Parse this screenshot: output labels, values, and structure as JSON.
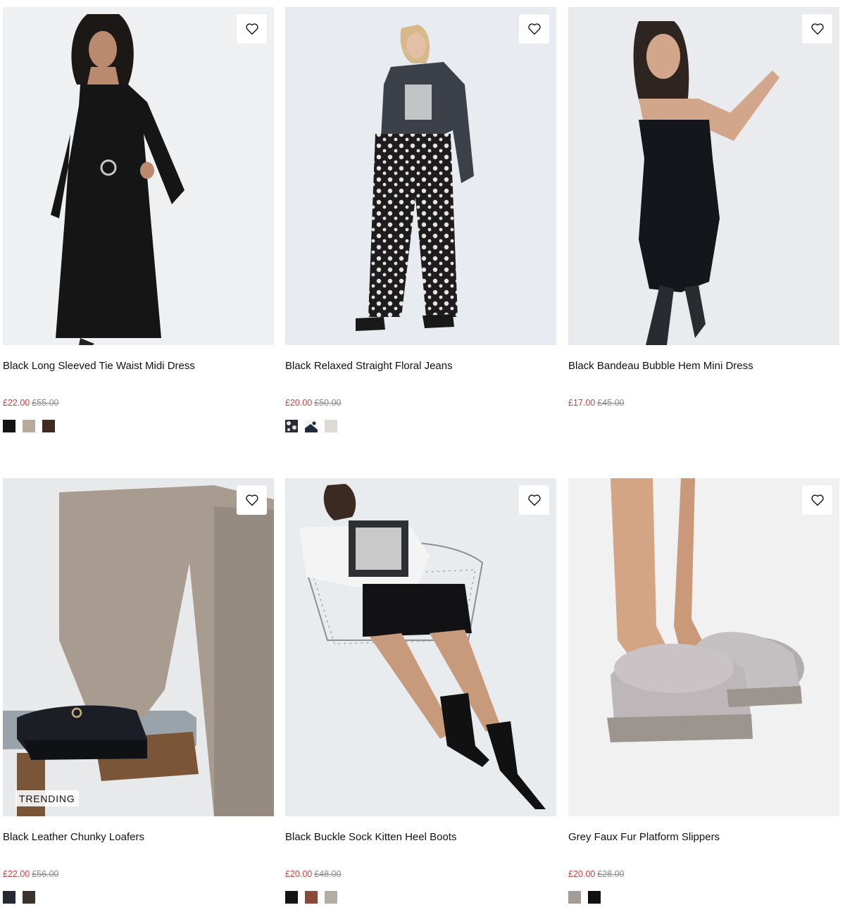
{
  "colors": {
    "sale_price": "#c8413f",
    "was_price": "#8a8a8a",
    "image_background": "#eef0f3"
  },
  "products": [
    {
      "title": "Black Long Sleeved Tie Waist Midi Dress",
      "price": "£22.00",
      "was_price": "£55.00",
      "badge": "",
      "swatches": [
        "#141414",
        "#b8ab9c",
        "#3f2a22"
      ]
    },
    {
      "title": "Black Relaxed Straight Floral Jeans",
      "price": "£20.00",
      "was_price": "£50.00",
      "badge": "",
      "swatches": [
        "pattern-floral-dark",
        "pattern-floral-navy",
        "#dedbd6"
      ]
    },
    {
      "title": "Black Bandeau Bubble Hem Mini Dress",
      "price": "£17.00",
      "was_price": "£45.00",
      "badge": "",
      "swatches": []
    },
    {
      "title": "Black Leather Chunky Loafers",
      "price": "£22.00",
      "was_price": "£56.00",
      "badge": "TRENDING",
      "swatches": [
        "#262a30",
        "#3b322c"
      ]
    },
    {
      "title": "Black Buckle Sock Kitten Heel Boots",
      "price": "£20.00",
      "was_price": "£48.00",
      "badge": "",
      "swatches": [
        "#141414",
        "#8a4a36",
        "#b3aca4"
      ]
    },
    {
      "title": "Grey Faux Fur Platform Slippers",
      "price": "£20.00",
      "was_price": "£28.00",
      "badge": "",
      "swatches": [
        "#a49c96",
        "#111111"
      ]
    }
  ]
}
